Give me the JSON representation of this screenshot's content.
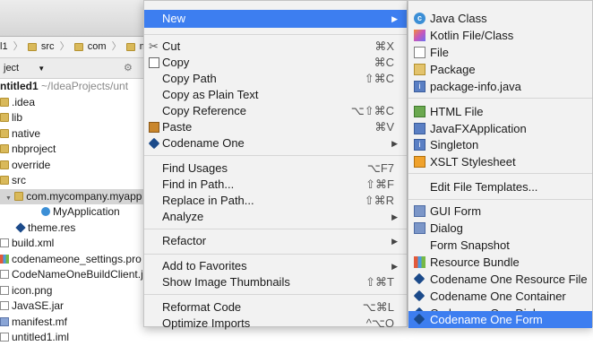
{
  "ide": {
    "breadcrumb": [
      "l1",
      "src",
      "com",
      "mycom"
    ],
    "view_selector": "ject",
    "tree": [
      {
        "label": "ntitled1",
        "suffix": " ~/IdeaProjects/unt",
        "kind": "root"
      },
      {
        "label": ".idea",
        "kind": "folder"
      },
      {
        "label": "lib",
        "kind": "folder"
      },
      {
        "label": "native",
        "kind": "folder"
      },
      {
        "label": "nbproject",
        "kind": "folder"
      },
      {
        "label": "override",
        "kind": "folder"
      },
      {
        "label": "src",
        "kind": "folder"
      },
      {
        "label": "com.mycompany.myapp",
        "kind": "package"
      },
      {
        "label": "MyApplication",
        "kind": "class"
      },
      {
        "label": "theme.res",
        "kind": "res"
      },
      {
        "label": "build.xml",
        "kind": "file"
      },
      {
        "label": "codenameone_settings.pro",
        "kind": "file"
      },
      {
        "label": "CodeNameOneBuildClient.j",
        "kind": "file"
      },
      {
        "label": "icon.png",
        "kind": "file"
      },
      {
        "label": "JavaSE.jar",
        "kind": "file"
      },
      {
        "label": "manifest.mf",
        "kind": "file"
      },
      {
        "label": "untitled1.iml",
        "kind": "file"
      }
    ]
  },
  "main_menu": {
    "new": {
      "label": "New"
    },
    "cut": {
      "label": "Cut",
      "shortcut": "⌘X"
    },
    "copy": {
      "label": "Copy",
      "shortcut": "⌘C"
    },
    "copy_path": {
      "label": "Copy Path",
      "shortcut": "⇧⌘C"
    },
    "copy_plain": {
      "label": "Copy as Plain Text"
    },
    "copy_reference": {
      "label": "Copy Reference",
      "shortcut": "⌥⇧⌘C"
    },
    "paste": {
      "label": "Paste",
      "shortcut": "⌘V"
    },
    "codename_one": {
      "label": "Codename One"
    },
    "find_usages": {
      "label": "Find Usages",
      "shortcut": "⌥F7"
    },
    "find_in_path": {
      "label": "Find in Path...",
      "shortcut": "⇧⌘F"
    },
    "replace_in_path": {
      "label": "Replace in Path...",
      "shortcut": "⇧⌘R"
    },
    "analyze": {
      "label": "Analyze"
    },
    "refactor": {
      "label": "Refactor"
    },
    "add_favorites": {
      "label": "Add to Favorites"
    },
    "show_thumbnails": {
      "label": "Show Image Thumbnails",
      "shortcut": "⇧⌘T"
    },
    "reformat": {
      "label": "Reformat Code",
      "shortcut": "⌥⌘L"
    },
    "optimize_imports": {
      "label": "Optimize Imports",
      "shortcut": "^⌥O"
    }
  },
  "sub_menu": {
    "java_class": {
      "label": "Java Class"
    },
    "kotlin": {
      "label": "Kotlin File/Class"
    },
    "file": {
      "label": "File"
    },
    "package": {
      "label": "Package"
    },
    "package_info": {
      "label": "package-info.java"
    },
    "html_file": {
      "label": "HTML File"
    },
    "javafx": {
      "label": "JavaFXApplication"
    },
    "singleton": {
      "label": "Singleton"
    },
    "xslt": {
      "label": "XSLT Stylesheet"
    },
    "edit_templates": {
      "label": "Edit File Templates..."
    },
    "gui_form": {
      "label": "GUI Form"
    },
    "dialog": {
      "label": "Dialog"
    },
    "form_snapshot": {
      "label": "Form Snapshot"
    },
    "resource_bundle": {
      "label": "Resource Bundle"
    },
    "cn1_resource": {
      "label": "Codename One Resource File"
    },
    "cn1_container": {
      "label": "Codename One Container"
    },
    "cn1_dialog": {
      "label": "Codename One Dialog"
    },
    "cn1_form": {
      "label": "Codename One Form"
    }
  },
  "colors": {
    "highlight": "#3d7ef0",
    "menu_bg": "#f2f2f2"
  }
}
